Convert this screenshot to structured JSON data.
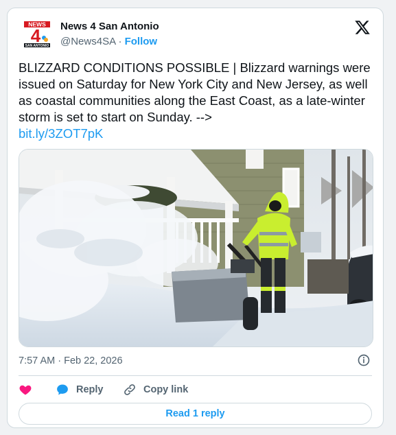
{
  "author": {
    "name": "News 4 San Antonio",
    "handle": "@News4SA",
    "separator": "·",
    "follow_label": "Follow",
    "logo_text": "NEWS",
    "logo_number": "4",
    "logo_subtext": "SAN ANTONIO"
  },
  "tweet": {
    "text": "BLIZZARD CONDITIONS POSSIBLE | Blizzard warnings were issued on Saturday for New York City and New Jersey, as well as coastal communities along the East Coast, as a late-winter storm is set to start on Sunday. -->",
    "link": "bit.ly/3ZOT7pK",
    "timestamp": "7:57 AM · Feb 22, 2026"
  },
  "actions": {
    "like_label": "",
    "reply_label": "Reply",
    "copy_label": "Copy link"
  },
  "read_reply_label": "Read 1 reply",
  "colors": {
    "accent": "#1d9bf0",
    "like": "#f91880",
    "text": "#0f1419",
    "muted": "#536471",
    "border": "#cfd9de",
    "logo_red": "#d71920"
  },
  "icons": {
    "platform": "x-logo-icon",
    "info": "info-icon",
    "like": "heart-icon",
    "reply": "reply-bubble-icon",
    "copy": "link-icon"
  }
}
